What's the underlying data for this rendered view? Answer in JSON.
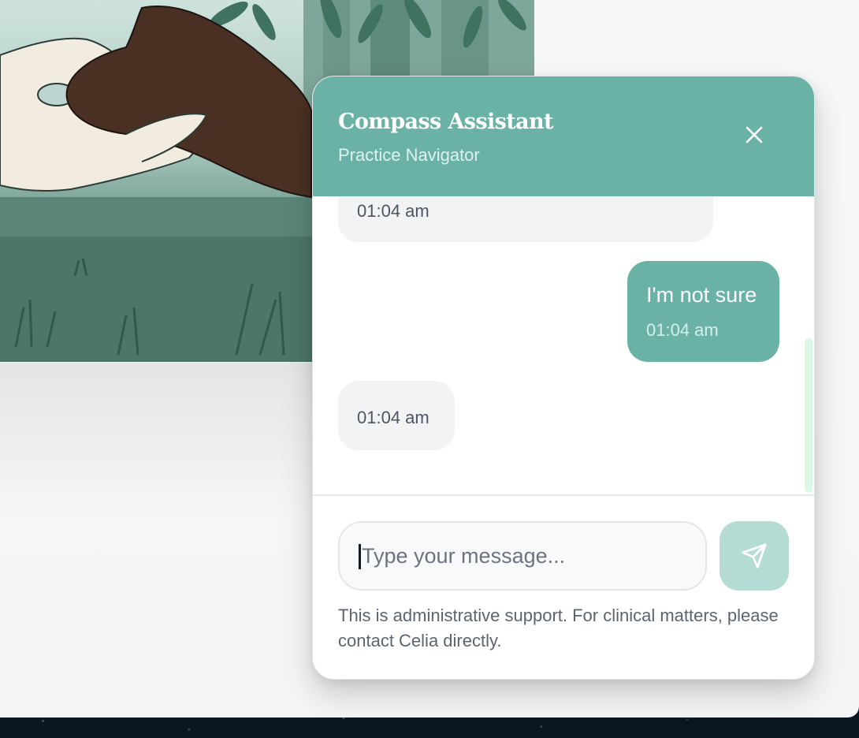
{
  "chat": {
    "title": "Compass Assistant",
    "subtitle": "Practice Navigator",
    "close_icon": "close-icon",
    "messages": [
      {
        "sender": "assistant",
        "text": "",
        "time": "01:04 am"
      },
      {
        "sender": "user",
        "text": "I'm not sure",
        "time": "01:04 am"
      },
      {
        "sender": "assistant",
        "text": "",
        "time": "01:04 am"
      }
    ],
    "input_placeholder": "Type your message...",
    "input_value": "",
    "send_icon": "send-icon",
    "disclaimer": "This is administrative support. For clinical matters, please contact Celia directly."
  },
  "colors": {
    "header": "#6ab2a6",
    "user_bubble": "#6ab2a6",
    "assistant_bubble": "#f2f3f5",
    "send_button": "#b4dcd4"
  }
}
